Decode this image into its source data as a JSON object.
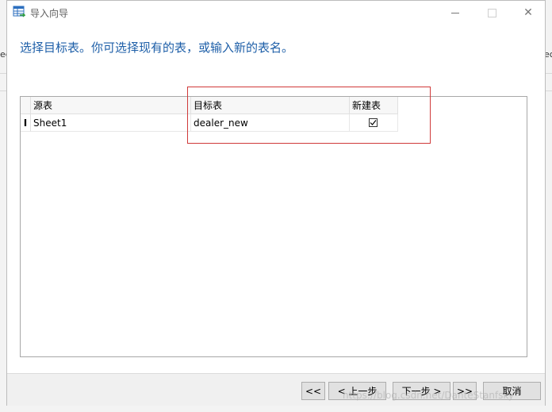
{
  "window": {
    "title": "导入向导",
    "minimize_glyph": "",
    "close_glyph": "✕"
  },
  "instruction": "选择目标表。你可选择现有的表，或输入新的表名。",
  "table": {
    "columns": [
      "源表",
      "目标表",
      "新建表"
    ],
    "rows": [
      {
        "source": "Sheet1",
        "target": "dealer_new",
        "create_new": true,
        "indicator": "I"
      }
    ]
  },
  "background": {
    "left_edge_text": "ec",
    "right_edge_text": "ec"
  },
  "footer": {
    "first_label": "<<",
    "prev_label": "< 上一步",
    "next_label": "下一步 >",
    "last_label": ">>",
    "cancel_label": "取消"
  },
  "watermark": "https://blog.csdn.net/DanteStanfsky",
  "colors": {
    "instruction": "#1e5fa8",
    "highlight_border": "#d03a3a"
  }
}
